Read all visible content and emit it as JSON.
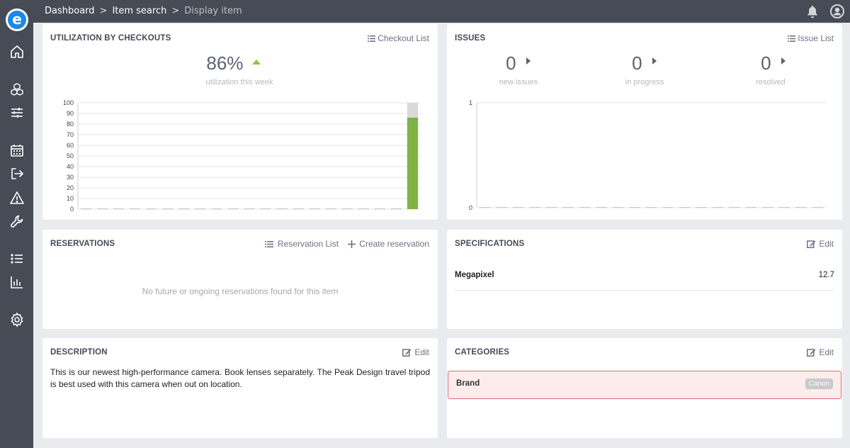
{
  "breadcrumb": {
    "items": [
      "Dashboard",
      "Item search"
    ],
    "current": "Display item"
  },
  "utilization": {
    "title": "UTILIZATION BY CHECKOUTS",
    "action_label": "Checkout List",
    "percent": "86%",
    "caption": "utilization this week",
    "trend": "up",
    "trend_color": "#8dc63f"
  },
  "issues": {
    "title": "ISSUES",
    "action_label": "Issue List",
    "stats": [
      {
        "value": "0",
        "label": "new issues"
      },
      {
        "value": "0",
        "label": "in progress"
      },
      {
        "value": "0",
        "label": "resolved"
      }
    ]
  },
  "reservations": {
    "title": "RESERVATIONS",
    "list_label": "Reservation List",
    "create_label": "Create reservation",
    "empty_message": "No future or ongoing reservations found for this item"
  },
  "specifications": {
    "title": "SPECIFICATIONS",
    "edit_label": "Edit",
    "rows": [
      {
        "key": "Megapixel",
        "value": "12.7"
      }
    ]
  },
  "description": {
    "title": "DESCRIPTION",
    "edit_label": "Edit",
    "text": "This is our newest high-performance camera. Book lenses separately. The Peak Design travel tripod is best used with this camera when out on location."
  },
  "categories": {
    "title": "CATEGORIES",
    "edit_label": "Edit",
    "rows": [
      {
        "key": "Brand",
        "value": "Canon"
      }
    ]
  },
  "colors": {
    "sidebar": "#464b55",
    "accent_green": "#7cb342",
    "bar_gray": "#d9d9d9",
    "danger_border": "#e16b6b",
    "danger_bg": "#fdecec"
  },
  "chart_data": [
    {
      "type": "bar",
      "title": "",
      "xlabel": "",
      "ylabel": "",
      "ylim": [
        0,
        100
      ],
      "yticks": [
        0,
        10,
        20,
        30,
        40,
        50,
        60,
        70,
        80,
        90,
        100
      ],
      "bar_count": 21,
      "series": [
        {
          "values": [
            0,
            0,
            0,
            0,
            0,
            0,
            0,
            0,
            0,
            0,
            0,
            0,
            0,
            0,
            0,
            0,
            0,
            0,
            0,
            0,
            86
          ],
          "color": "#7cb342"
        },
        {
          "values": [
            0,
            0,
            0,
            0,
            0,
            0,
            0,
            0,
            0,
            0,
            0,
            0,
            0,
            0,
            0,
            0,
            0,
            0,
            0,
            0,
            14
          ],
          "color": "#d9d9d9"
        }
      ],
      "stacked": true,
      "grid": true
    },
    {
      "type": "bar",
      "title": "",
      "xlabel": "",
      "ylabel": "",
      "ylim": [
        0,
        1
      ],
      "yticks": [
        0,
        1
      ],
      "bar_count": 21,
      "series": [
        {
          "values": [
            0,
            0,
            0,
            0,
            0,
            0,
            0,
            0,
            0,
            0,
            0,
            0,
            0,
            0,
            0,
            0,
            0,
            0,
            0,
            0,
            0
          ]
        }
      ],
      "grid": true
    }
  ],
  "icons": {
    "sidebar": [
      "home-icon",
      "boxes-icon",
      "sliders-icon",
      "calendar-icon",
      "logout-icon",
      "warning-icon",
      "wrench-icon",
      "list-icon",
      "chart-icon",
      "gear-icon"
    ],
    "top": [
      "bell-icon",
      "user-icon"
    ]
  }
}
